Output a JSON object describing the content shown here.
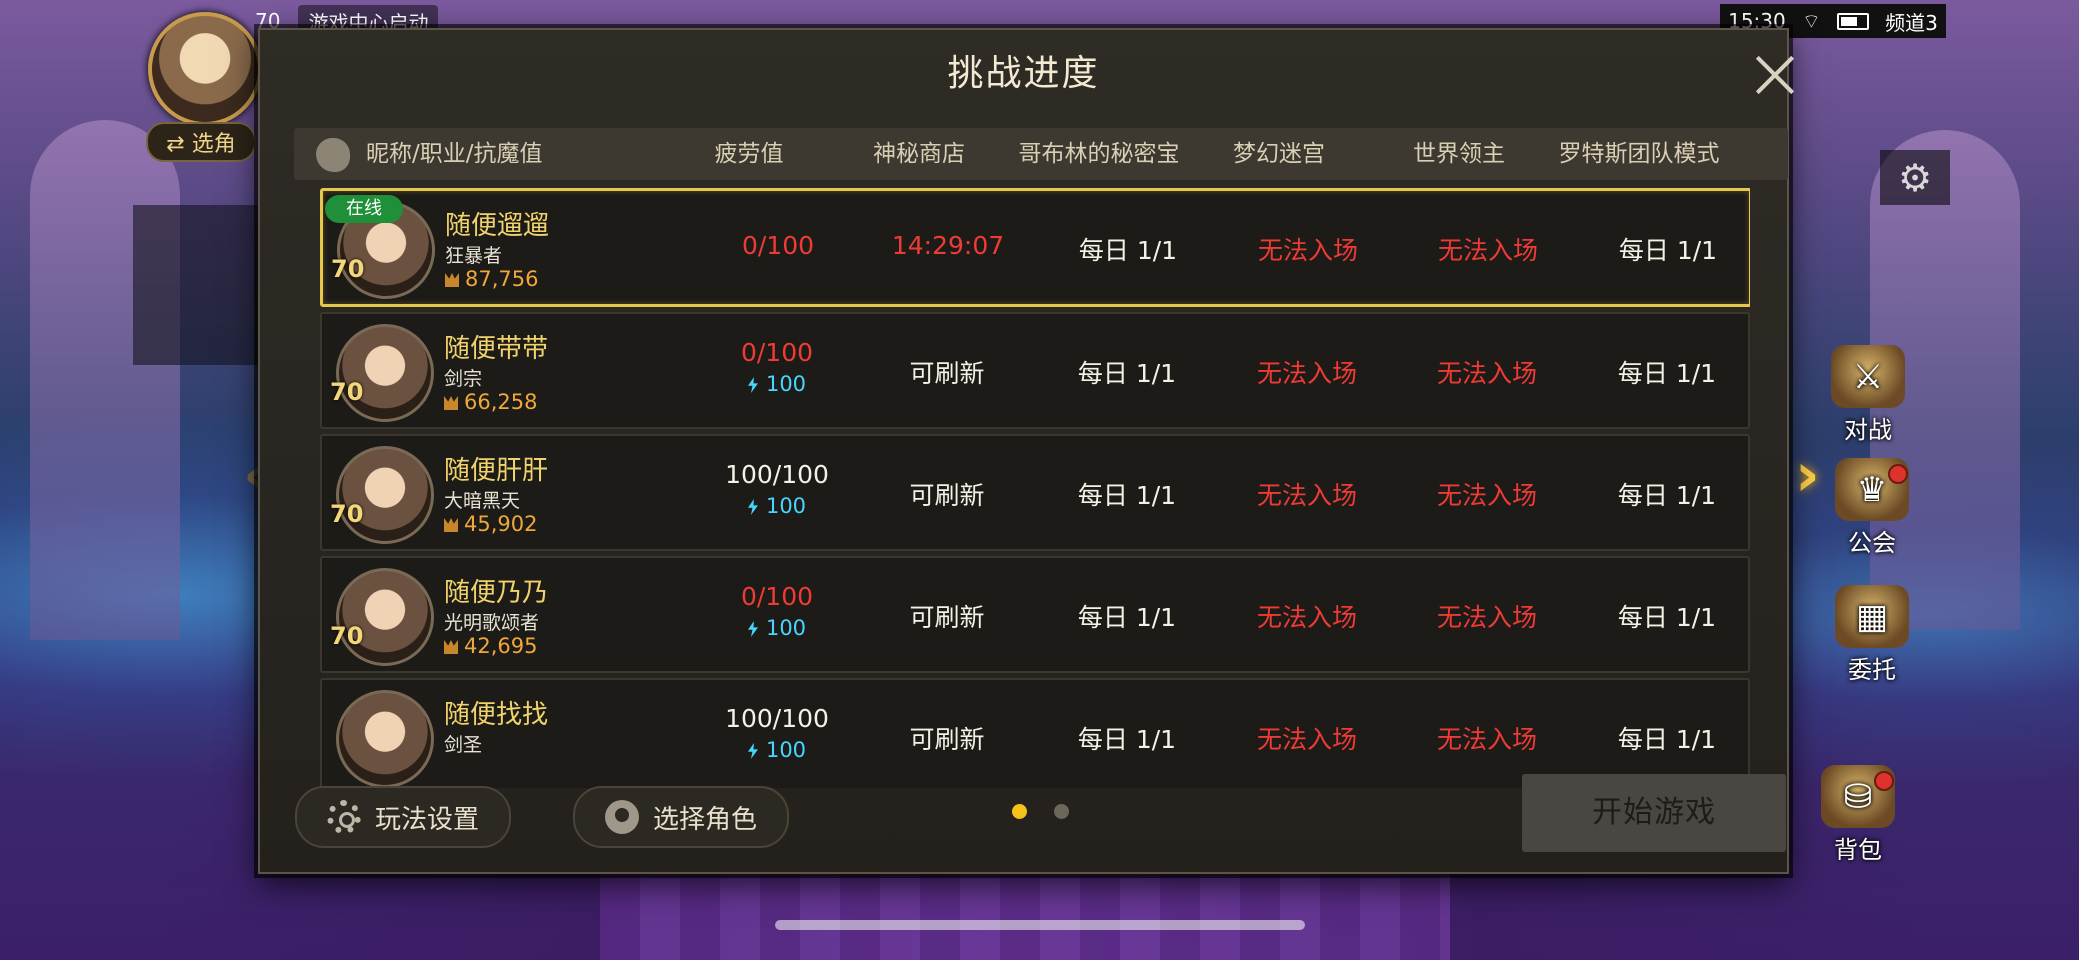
{
  "status_bar": {
    "level": "70",
    "notice": "游戏中心启动",
    "time": "15:30",
    "channel": "频道3"
  },
  "hud": {
    "select_role_label": "⇄ 选角",
    "right_buttons": [
      {
        "label": "对战",
        "icon": "crossed-swords-icon"
      },
      {
        "label": "公会",
        "icon": "guild-crest-icon"
      },
      {
        "label": "委托",
        "icon": "commission-board-icon"
      },
      {
        "label": "背包",
        "icon": "backpack-icon"
      }
    ]
  },
  "dialog": {
    "title": "挑战进度",
    "columns": {
      "name": "昵称/职业/抗魔值",
      "fatigue": "疲劳值",
      "shop": "神秘商店",
      "goblin": "哥布林的秘密宝库",
      "maze": "梦幻迷宫",
      "boss": "世界领主",
      "raid": "罗特斯团队模式"
    },
    "online_badge": "在线",
    "rows": [
      {
        "name": "随便遛遛",
        "class": "狂暴者",
        "score": "87,756",
        "level": "70",
        "online": true,
        "fatigue": "0/100",
        "fatigue_recover": "",
        "shop": "14:29:07",
        "goblin": "每日 1/1",
        "maze": "无法入场",
        "boss": "无法入场",
        "raid": "每日 1/1"
      },
      {
        "name": "随便带带",
        "class": "剑宗",
        "score": "66,258",
        "level": "70",
        "online": false,
        "fatigue": "0/100",
        "fatigue_recover": "100",
        "shop": "可刷新",
        "goblin": "每日 1/1",
        "maze": "无法入场",
        "boss": "无法入场",
        "raid": "每日 1/1"
      },
      {
        "name": "随便肝肝",
        "class": "大暗黑天",
        "score": "45,902",
        "level": "70",
        "online": false,
        "fatigue": "100/100",
        "fatigue_recover": "100",
        "shop": "可刷新",
        "goblin": "每日 1/1",
        "maze": "无法入场",
        "boss": "无法入场",
        "raid": "每日 1/1"
      },
      {
        "name": "随便乃乃",
        "class": "光明歌颂者",
        "score": "42,695",
        "level": "70",
        "online": false,
        "fatigue": "0/100",
        "fatigue_recover": "100",
        "shop": "可刷新",
        "goblin": "每日 1/1",
        "maze": "无法入场",
        "boss": "无法入场",
        "raid": "每日 1/1"
      },
      {
        "name": "随便找找",
        "class": "剑圣",
        "score": "",
        "level": "",
        "online": false,
        "fatigue": "100/100",
        "fatigue_recover": "100",
        "shop": "可刷新",
        "goblin": "每日 1/1",
        "maze": "无法入场",
        "boss": "无法入场",
        "raid": "每日 1/1"
      }
    ],
    "footer": {
      "settings_label": "玩法设置",
      "select_role_label": "选择角色",
      "start_label": "开始游戏",
      "page": 1,
      "page_count": 2
    }
  },
  "colors": {
    "accent_gold": "#f1d36b",
    "unavailable_red": "#ee3b35",
    "energy_cyan": "#46d6ff",
    "online_green": "#1f8f3a",
    "selected_border": "#e6c84a"
  }
}
